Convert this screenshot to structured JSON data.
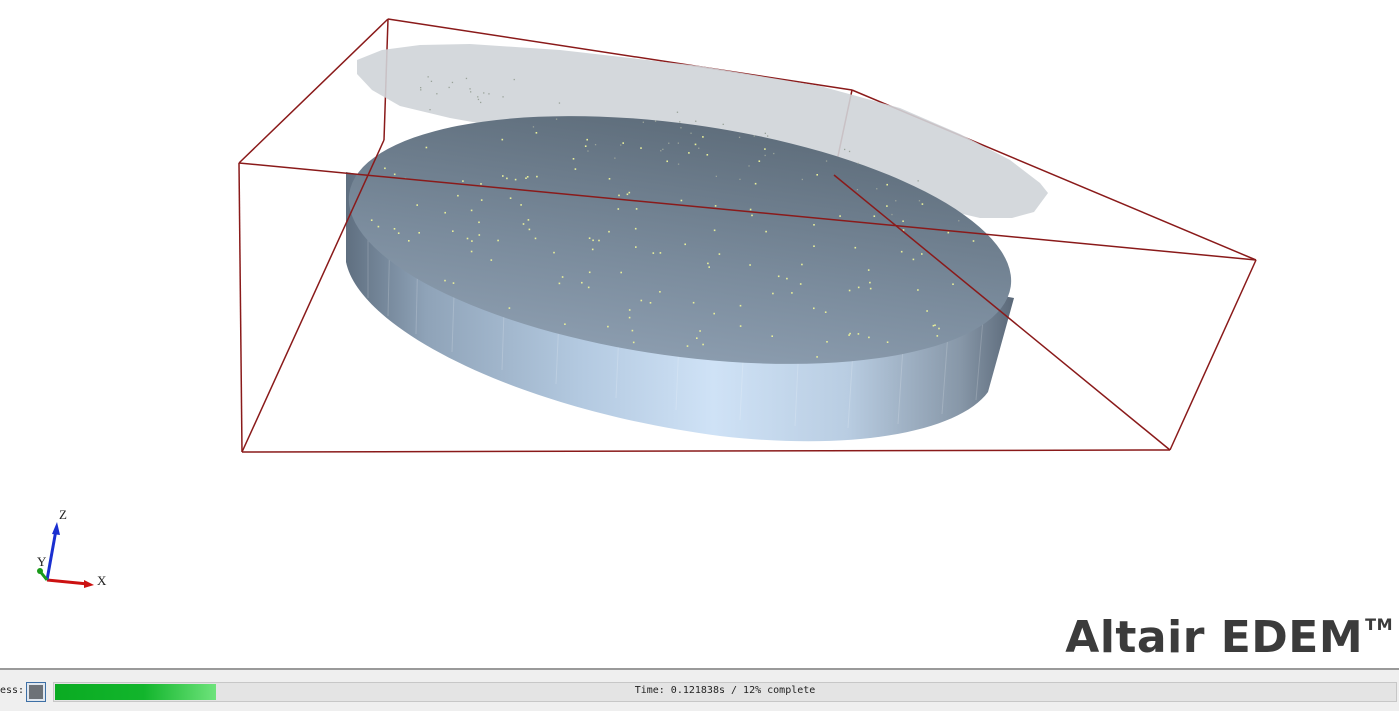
{
  "viewport": {
    "axes": {
      "z_label": "Z",
      "y_label": "Y",
      "x_label": "X"
    }
  },
  "brand": {
    "name": "Altair EDEM",
    "trademark": "TM"
  },
  "statusbar": {
    "label": "ess:",
    "progress_text": "Time: 0.121838s / 12% complete",
    "progress_percent": 12
  },
  "colors": {
    "domain_box": "#8a1a1a",
    "cylinder_top": "#7a8a9a",
    "cylinder_side": "#b6cde3",
    "upper_plate": "#d3d8dc",
    "particles": "#e8ef9a",
    "progress_fill": "#0aab22"
  },
  "icons": {
    "stop": "stop-square-icon",
    "triad": "xyz-axis-triad-icon"
  }
}
